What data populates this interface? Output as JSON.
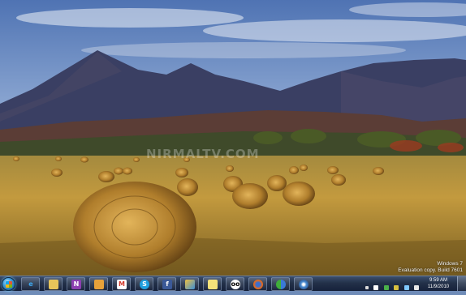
{
  "desktop": {
    "wallpaper_name": "hay bales field with mountains",
    "watermark": "NIRMALTV.COM"
  },
  "evaluation": {
    "line1": "Windows 7",
    "line2": "Evaluation copy. Build 7601"
  },
  "taskbar": {
    "start_icon": "windows-logo-icon",
    "pinned": [
      {
        "name": "internet-explorer",
        "icon": "e"
      },
      {
        "name": "windows-explorer",
        "icon": "folder"
      },
      {
        "name": "onenote",
        "icon": "N"
      },
      {
        "name": "outlook",
        "icon": "envelope"
      },
      {
        "name": "gmail",
        "icon": "M"
      },
      {
        "name": "skype",
        "icon": "S"
      },
      {
        "name": "facebook",
        "icon": "f"
      },
      {
        "name": "paint",
        "icon": "brush"
      },
      {
        "name": "sticky-notes",
        "icon": "note"
      },
      {
        "name": "tripadvisor",
        "icon": "owl"
      },
      {
        "name": "firefox",
        "icon": "fox"
      },
      {
        "name": "messenger",
        "icon": "people"
      },
      {
        "name": "media-center",
        "icon": "disc"
      }
    ],
    "clock": {
      "time": "9:59 AM",
      "date": "11/9/2010"
    }
  }
}
